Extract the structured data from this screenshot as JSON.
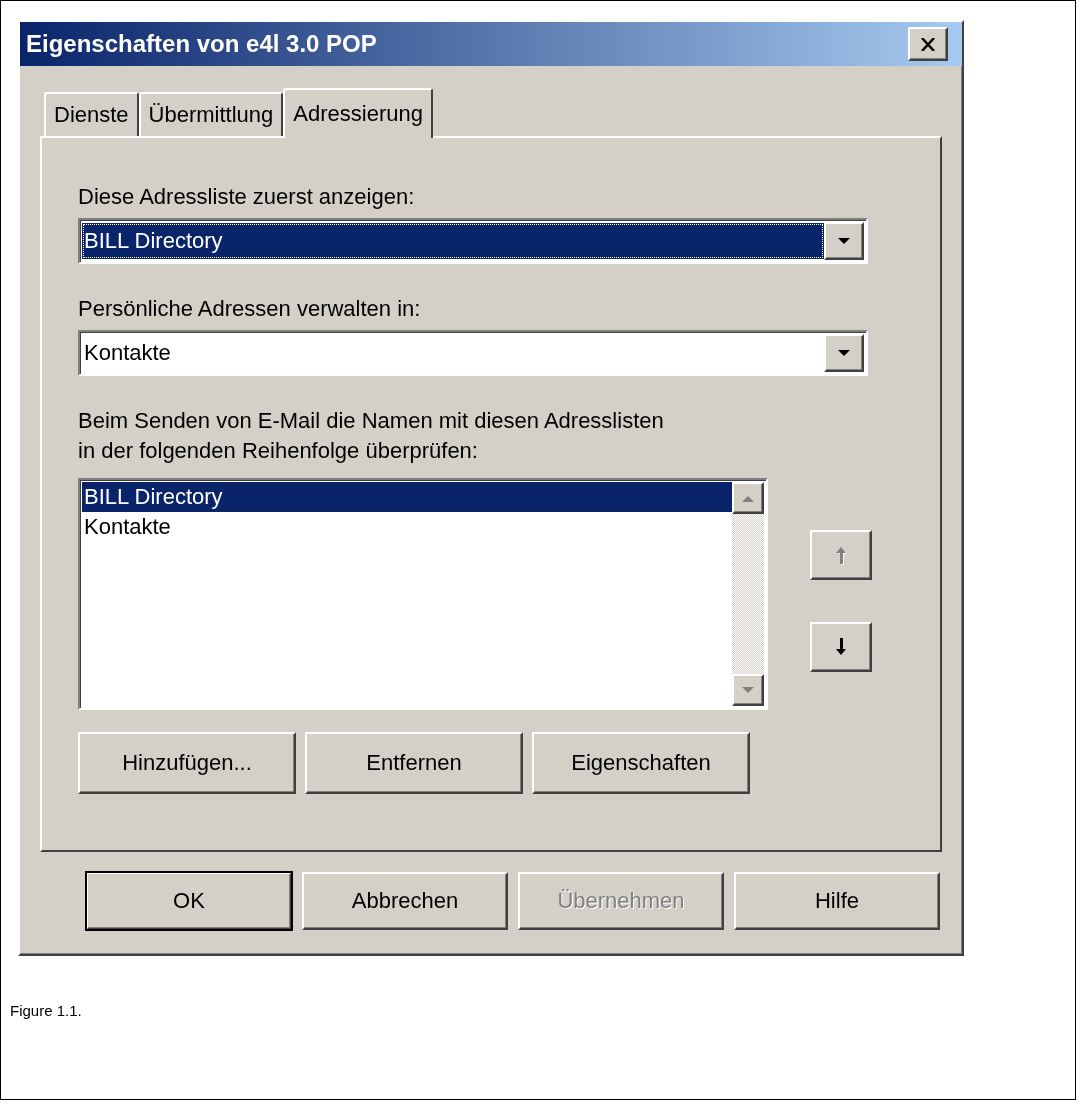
{
  "window": {
    "title": "Eigenschaften von e4l 3.0 POP"
  },
  "tabs": [
    {
      "label": "Dienste",
      "selected": false
    },
    {
      "label": "Übermittlung",
      "selected": false
    },
    {
      "label": "Adressierung",
      "selected": true
    }
  ],
  "first_list": {
    "label": "Diese Adressliste zuerst anzeigen:",
    "value": "BILL Directory",
    "focused": true
  },
  "personal_addresses": {
    "label": "Persönliche Adressen verwalten in:",
    "value": "Kontakte",
    "focused": false
  },
  "check_order": {
    "label": "Beim Senden von E-Mail die Namen mit diesen Adresslisten\nin der folgenden Reihenfolge überprüfen:",
    "items": [
      {
        "label": "BILL Directory",
        "selected": true
      },
      {
        "label": "Kontakte",
        "selected": false
      }
    ],
    "move_up": {
      "disabled": true
    },
    "move_down": {
      "disabled": false
    }
  },
  "list_buttons": [
    "Hinzufügen...",
    "Entfernen",
    "Eigenschaften"
  ],
  "dialog_buttons": [
    {
      "label": "OK",
      "default": true,
      "disabled": false
    },
    {
      "label": "Abbrechen",
      "default": false,
      "disabled": false
    },
    {
      "label": "Übernehmen",
      "default": false,
      "disabled": true
    },
    {
      "label": "Hilfe",
      "default": false,
      "disabled": false
    }
  ],
  "caption": "Figure 1.1."
}
